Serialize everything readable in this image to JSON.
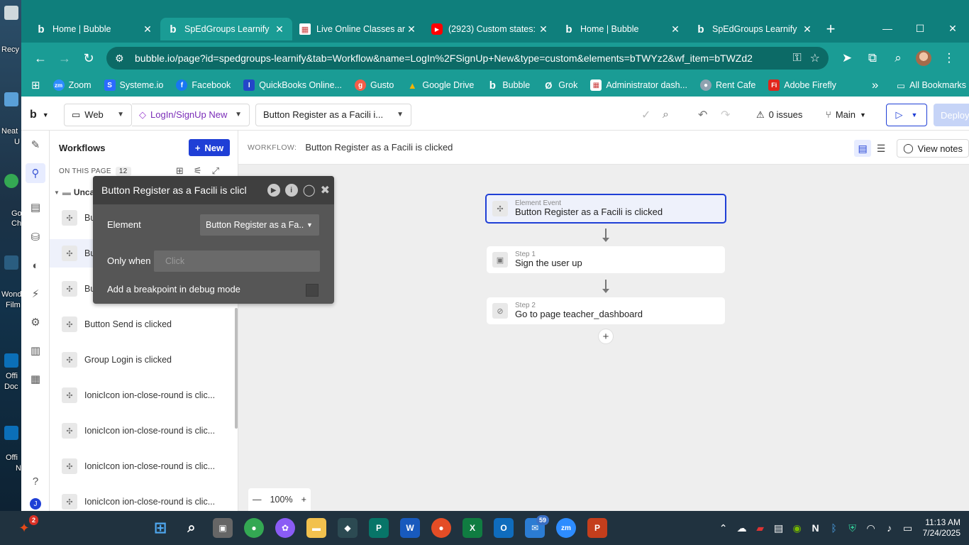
{
  "desktop": {
    "labels": [
      "Recy",
      "Neat",
      "U",
      "Go",
      "Ch",
      "Wond",
      "Film",
      "Offi",
      "Doc",
      "Offi",
      "N"
    ]
  },
  "browser": {
    "tabs": [
      {
        "title": "Home | Bubble",
        "icon": "bubble-icon",
        "active": false
      },
      {
        "title": "SpEdGroups Learnify",
        "icon": "bubble-icon",
        "active": true
      },
      {
        "title": "Live Online Classes ar",
        "icon": "grid-icon",
        "active": false
      },
      {
        "title": "(2923) Custom states:",
        "icon": "youtube-icon",
        "active": false
      },
      {
        "title": "Home | Bubble",
        "icon": "bubble-icon",
        "active": false
      },
      {
        "title": "SpEdGroups Learnify",
        "icon": "bubble-icon",
        "active": false
      }
    ],
    "url": "bubble.io/page?id=spedgroups-learnify&tab=Workflow&name=LogIn%2FSignUp+New&type=custom&elements=bTWYz2&wf_item=bTWZd2",
    "bookmarks": [
      {
        "label": "Zoom",
        "color": "#2d8cff",
        "glyph": "zm"
      },
      {
        "label": "Systeme.io",
        "color": "#2b6bff",
        "glyph": "S"
      },
      {
        "label": "Facebook",
        "color": "#1877f2",
        "glyph": "f"
      },
      {
        "label": "QuickBooks Online...",
        "color": "#2446c8",
        "glyph": "I"
      },
      {
        "label": "Gusto",
        "color": "#f45d48",
        "glyph": "g"
      },
      {
        "label": "Google Drive",
        "color": "#f4b400",
        "glyph": "▲"
      },
      {
        "label": "Bubble",
        "color": "#0f7f7c",
        "glyph": "b"
      },
      {
        "label": "Grok",
        "color": "#0f7f7c",
        "glyph": "Ø"
      },
      {
        "label": "Administrator dash...",
        "color": "#ffffff",
        "glyph": "▦"
      },
      {
        "label": "Rent Cafe",
        "color": "#8fa2b0",
        "glyph": "●"
      },
      {
        "label": "Adobe Firefly",
        "color": "#e1251b",
        "glyph": "Fi"
      }
    ],
    "bookmarks_more": "»",
    "all_bookmarks": "All Bookmarks"
  },
  "editor": {
    "logo": "b",
    "device": "Web",
    "page": "LogIn/SignUp New",
    "workflow_select": "Button Register as a Facili i...",
    "issues": "0 issues",
    "branch": "Main",
    "deploy": "Deploy",
    "workflows_title": "Workflows",
    "new_button": "New",
    "on_this_page": "ON THIS PAGE",
    "on_this_page_count": "12",
    "folder_label": "Unca",
    "items": [
      {
        "label": "Bu",
        "selected": false
      },
      {
        "label": "Bu",
        "selected": true
      },
      {
        "label": "Bu",
        "selected": false
      },
      {
        "label": "Button Send is clicked",
        "selected": false
      },
      {
        "label": "Group Login is clicked",
        "selected": false
      },
      {
        "label": "IonicIcon ion-close-round is clic...",
        "selected": false
      },
      {
        "label": "IonicIcon ion-close-round is clic...",
        "selected": false
      },
      {
        "label": "IonicIcon ion-close-round is clic...",
        "selected": false
      },
      {
        "label": "IonicIcon ion-close-round is clic...",
        "selected": false
      }
    ],
    "rail_help": "?",
    "rail_user": "J",
    "breadcrumb_key": "WORKFLOW:",
    "breadcrumb_value": "Button Register as a Facili is clicked",
    "view_notes": "View notes",
    "event_node": {
      "kind": "Element Event",
      "title": "Button Register as a Facili is clicked"
    },
    "steps": [
      {
        "kind": "Step 1",
        "title": "Sign the user up"
      },
      {
        "kind": "Step 2",
        "title": "Go to page teacher_dashboard"
      }
    ],
    "zoom_minus": "—",
    "zoom_level": "100%",
    "zoom_plus": "+",
    "add_step": "+"
  },
  "property_editor": {
    "title": "Button Register as a Facili is clicl",
    "element_label": "Element",
    "element_value": "Button Register as a Fa...",
    "only_when_label": "Only when",
    "only_when_placeholder": "Click",
    "breakpoint_label": "Add a breakpoint in debug mode"
  },
  "taskbar": {
    "notification_count": "2",
    "mail_badge": "59",
    "time": "11:13 AM",
    "date": "7/24/2025"
  },
  "colors": {
    "browser_teal": "#1a9c95",
    "bubble_blue": "#1f3fd6",
    "editor_dark": "#565656"
  }
}
